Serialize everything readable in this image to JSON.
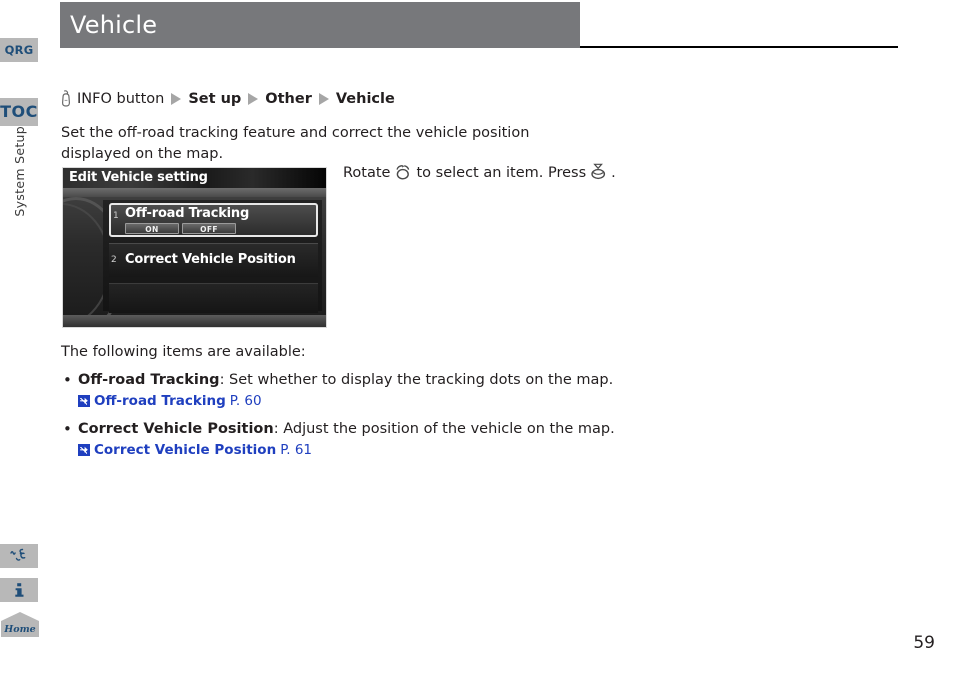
{
  "page": {
    "title": "Vehicle",
    "number": "59"
  },
  "sidebar": {
    "tabs": [
      {
        "id": "qrg",
        "label": "QRG",
        "icon": "qrg-tab"
      },
      {
        "id": "toc",
        "label": "TOC",
        "icon": "toc-tab"
      }
    ],
    "section_label": "System Setup",
    "bottom_tabs": [
      {
        "id": "script",
        "label": "",
        "icon": "script-mark-icon"
      },
      {
        "id": "info",
        "label": "",
        "icon": "info-i-icon"
      },
      {
        "id": "home",
        "label": "Home",
        "icon": "home-house-icon"
      }
    ]
  },
  "breadcrumb": {
    "icon": "press-button-icon",
    "items": [
      {
        "text": "INFO button",
        "strong": false
      },
      {
        "text": "Set up",
        "strong": true
      },
      {
        "text": "Other",
        "strong": true
      },
      {
        "text": "Vehicle",
        "strong": true
      }
    ],
    "separator": "triangle-right-icon"
  },
  "intro": "Set the off-road tracking feature and correct the vehicle position displayed on the map.",
  "screenshot": {
    "header": "Edit Vehicle setting",
    "items": [
      {
        "number": "1",
        "label": "Off-road Tracking",
        "buttons": [
          "ON",
          "OFF"
        ],
        "selected": true
      },
      {
        "number": "2",
        "label": "Correct Vehicle Position",
        "buttons": [],
        "selected": false
      }
    ]
  },
  "caption": {
    "part1": "Rotate",
    "rotate_icon": "rotate-knob-icon",
    "part2": "to select an item. Press",
    "press_icon": "press-knob-icon",
    "part3": "."
  },
  "body": {
    "lead": "The following items are available:",
    "bullets": [
      {
        "term": "Off-road Tracking",
        "description": ": Set whether to display the tracking dots on the map.",
        "xref": {
          "icon": "jump-link-icon",
          "title": "Off-road Tracking",
          "page": "P. 60"
        }
      },
      {
        "term": "Correct Vehicle Position",
        "description": ": Adjust the position of the vehicle on the map.",
        "xref": {
          "icon": "jump-link-icon",
          "title": "Correct Vehicle Position",
          "page": "P. 61"
        }
      }
    ]
  },
  "colors": {
    "title_bar": "#77787b",
    "tab_bg": "#b8b8b8",
    "tab_text": "#1f4e79",
    "link": "#1f3fbf",
    "body_text": "#231f20"
  }
}
